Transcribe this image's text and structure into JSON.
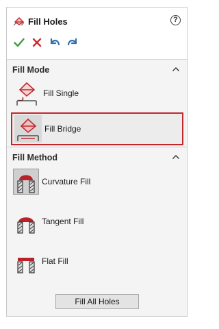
{
  "panel": {
    "title": "Fill Holes",
    "help_icon": "question-circle-icon",
    "help_glyph": "?"
  },
  "actions": [
    {
      "name": "ok",
      "icon": "checkmark-icon",
      "color": "#3a9c3a"
    },
    {
      "name": "cancel",
      "icon": "x-icon",
      "color": "#d42a2a"
    },
    {
      "name": "undo",
      "icon": "undo-icon",
      "color": "#2f6fb3"
    },
    {
      "name": "redo",
      "icon": "redo-icon",
      "color": "#2f6fb3"
    }
  ],
  "fill_mode": {
    "label": "Fill Mode",
    "options": [
      {
        "label": "Fill Single",
        "selected": false
      },
      {
        "label": "Fill Bridge",
        "selected": true
      }
    ]
  },
  "fill_method": {
    "label": "Fill Method",
    "options": [
      {
        "label": "Curvature Fill",
        "selected": true
      },
      {
        "label": "Tangent Fill",
        "selected": false
      },
      {
        "label": "Flat Fill",
        "selected": false
      }
    ]
  },
  "fill_all_button": "Fill All Holes",
  "colors": {
    "accent_red": "#c0282d",
    "fill_red": "#c0282d",
    "ok_green": "#3a9c3a",
    "cancel_red": "#d42a2a",
    "arrow_blue": "#2f6fb3"
  }
}
